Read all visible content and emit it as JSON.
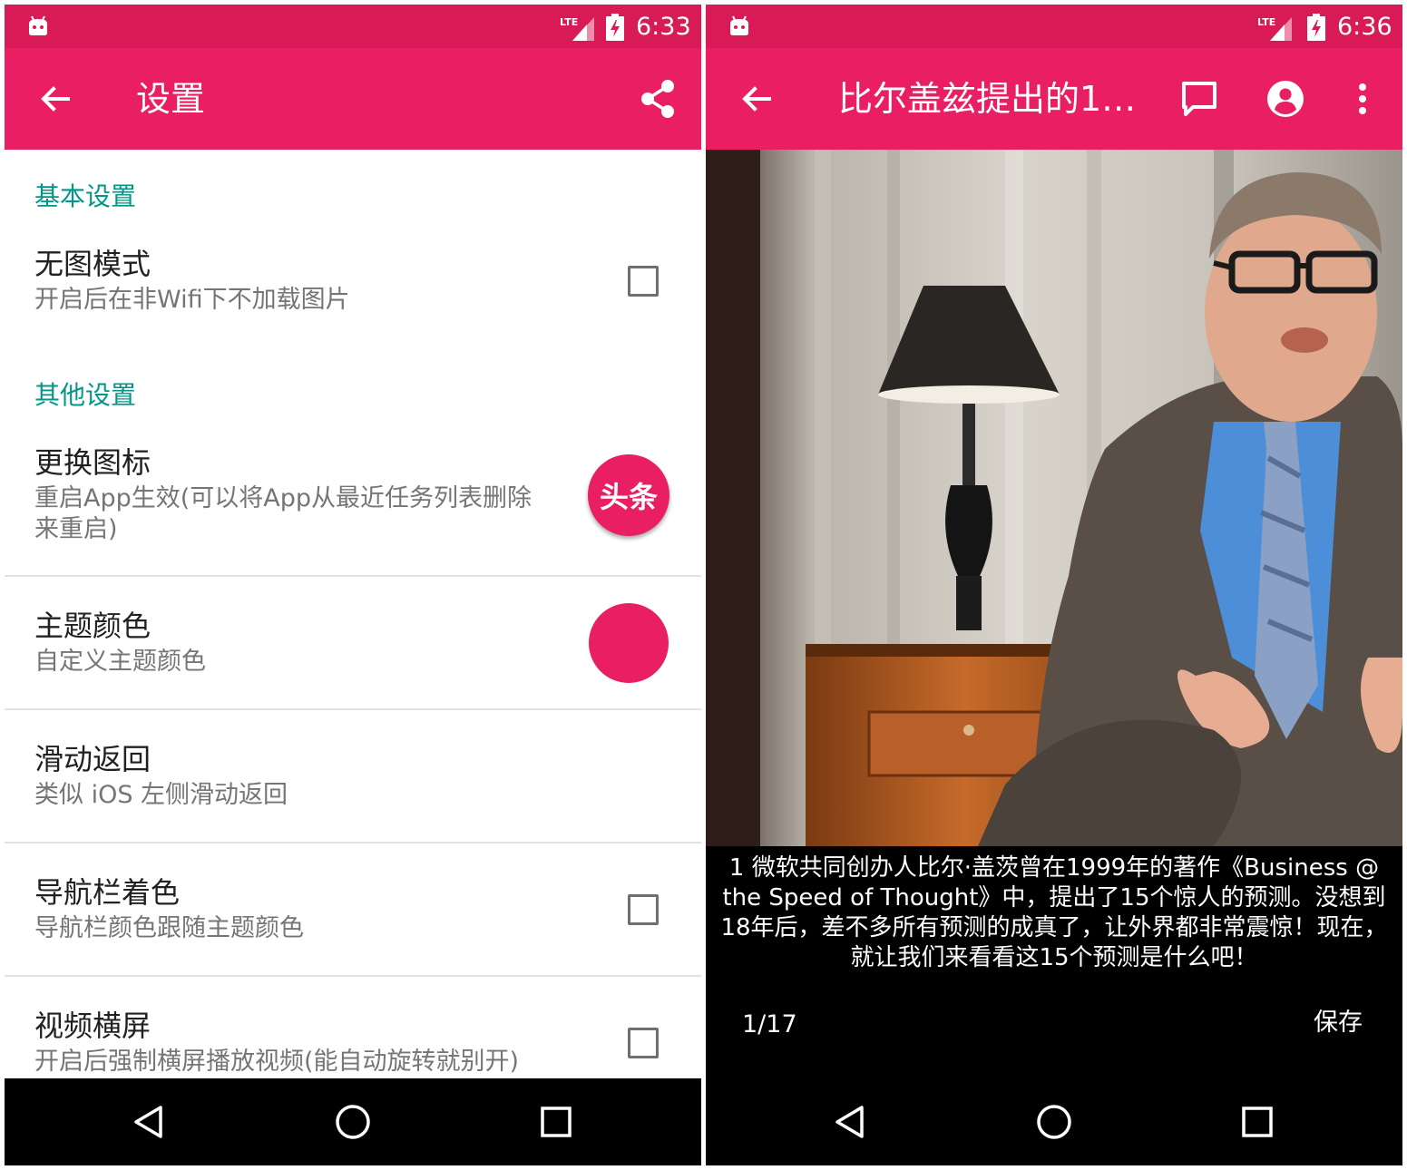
{
  "colors": {
    "primary": "#e91e63",
    "primary_dark": "#d81b56",
    "accent_text": "#009688"
  },
  "left": {
    "status": {
      "clock": "6:33",
      "network": "LTE"
    },
    "toolbar": {
      "title": "设置"
    },
    "sections": {
      "basic": {
        "label": "基本设置"
      },
      "other": {
        "label": "其他设置"
      }
    },
    "prefs": {
      "no_image": {
        "title": "无图模式",
        "summary": "开启后在非Wifi下不加载图片",
        "checked": false
      },
      "change_icon": {
        "title": "更换图标",
        "summary": "重启App生效(可以将App从最近任务列表删除来重启)",
        "icon_text": "头条"
      },
      "theme_color": {
        "title": "主题颜色",
        "summary": "自定义主题颜色",
        "color": "#e91e63"
      },
      "swipe_back": {
        "title": "滑动返回",
        "summary": "类似 iOS 左侧滑动返回"
      },
      "navbar_tint": {
        "title": "导航栏着色",
        "summary": "导航栏颜色跟随主题颜色",
        "checked": false
      },
      "video_landscape": {
        "title": "视频横屏",
        "summary": "开启后强制横屏播放视频(能自动旋转就别开)",
        "checked": false
      }
    }
  },
  "right": {
    "status": {
      "clock": "6:36",
      "network": "LTE"
    },
    "toolbar": {
      "title": "比尔盖兹提出的1…"
    },
    "caption": "1 微软共同创办人比尔·盖茨曾在1999年的著作《Business @ the Speed of Thought》中，提出了15个惊人的预测。没想到18年后，差不多所有预测的成真了，让外界都非常震惊！现在，就让我们来看看这15个预测是什么吧！",
    "page_indicator": "1/17",
    "save_label": "保存"
  }
}
